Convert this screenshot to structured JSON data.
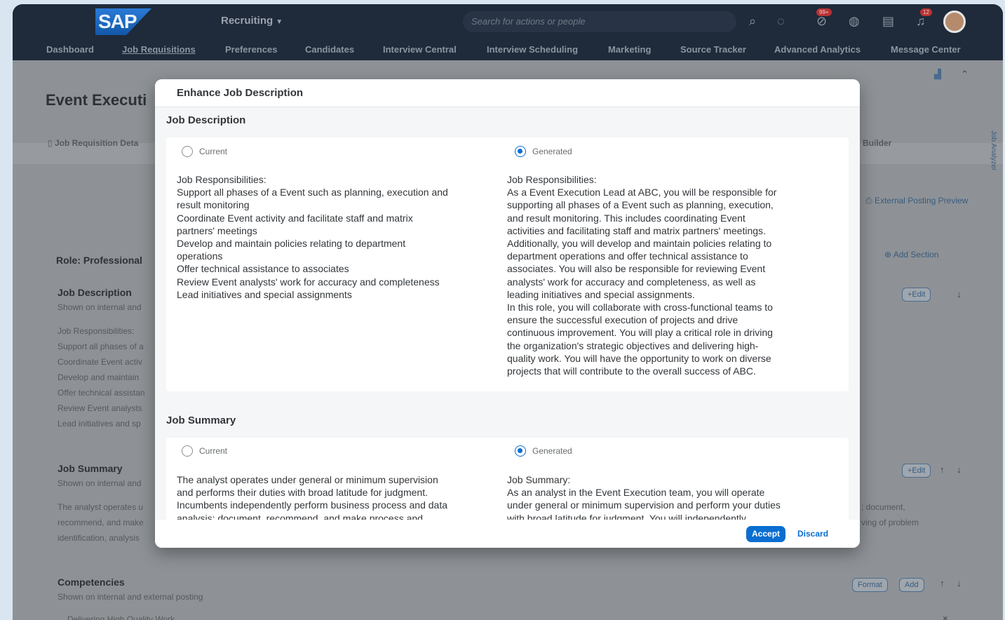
{
  "shell": {
    "logo": "SAP",
    "app": "Recruiting",
    "search_placeholder": "Search for actions or people",
    "notif_badge_1": "99+",
    "notif_badge_2": "12"
  },
  "nav": [
    "Dashboard",
    "Job Requisitions",
    "Preferences",
    "Candidates",
    "Interview Central",
    "Interview Scheduling",
    "Marketing",
    "Source Tracker",
    "Advanced Analytics",
    "Message Center"
  ],
  "background": {
    "page_title": "Event Executi",
    "tab_label": "Job Requisition Deta",
    "builder": "Builder",
    "role": "Role: Professional",
    "external_preview": "External Posting Preview",
    "add_section": "Add Section",
    "job_description_title": "Job Description",
    "shown_short": "Shown on internal and",
    "jd_lines": [
      "Job Responsibilities:",
      "Support all phases of a",
      "Coordinate Event activ",
      "Develop and maintain",
      "Offer technical assistan",
      "Review Event analysts",
      "Lead initiatives and sp"
    ],
    "job_summary_title": "Job Summary",
    "js_lines": [
      "The analyst operates u",
      "recommend, and make",
      "identification, analysis"
    ],
    "right_frag_1": "; document,",
    "right_frag_2": "ving of problem",
    "competencies_title": "Competencies",
    "competencies_shown": "Shown on internal and external posting",
    "competency_1": "Delivering High Quality Work",
    "edit_label": "+Edit",
    "format_label": "Format",
    "add_label": "Add",
    "side_tab": "Job Analyzer"
  },
  "dialog": {
    "title": "Enhance Job Description",
    "description": {
      "title": "Job Description",
      "current_label": "Current",
      "generated_label": "Generated",
      "current_text": "Job Responsibilities:\nSupport all phases of a Event such as planning, execution and\nresult monitoring\nCoordinate Event activity and facilitate staff and matrix\npartners' meetings\nDevelop and maintain policies relating to department\noperations\nOffer technical assistance to associates\nReview Event analysts' work for accuracy and completeness\nLead initiatives and special assignments",
      "generated_text": "Job Responsibilities:\nAs a Event Execution Lead at ABC, you will be responsible for\nsupporting all phases of a Event such as planning, execution,\nand result monitoring. This includes coordinating Event\nactivities and facilitating staff and matrix partners' meetings.\nAdditionally, you will develop and maintain policies relating to\ndepartment operations and offer technical assistance to\nassociates. You will also be responsible for reviewing Event\nanalysts' work for accuracy and completeness, as well as\nleading initiatives and special assignments.\nIn this role, you will collaborate with cross-functional teams to\nensure the successful execution of projects and drive\ncontinuous improvement. You will play a critical role in driving\nthe organization's strategic objectives and delivering high-\nquality work. You will have the opportunity to work on diverse\nprojects that will contribute to the overall success of ABC."
    },
    "summary": {
      "title": "Job Summary",
      "current_label": "Current",
      "generated_label": "Generated",
      "current_text": "The analyst operates under general or minimum supervision\nand performs their duties with broad latitude for judgment.\nIncumbents independently perform business process and data\nanalysis; document, recommend, and make process and",
      "generated_text": "Job Summary:\nAs an analyst in the Event Execution team, you will operate\nunder general or minimum supervision and perform your duties\nwith broad latitude for judgment. You will independently"
    },
    "accept_label": "Accept",
    "discard_label": "Discard"
  }
}
